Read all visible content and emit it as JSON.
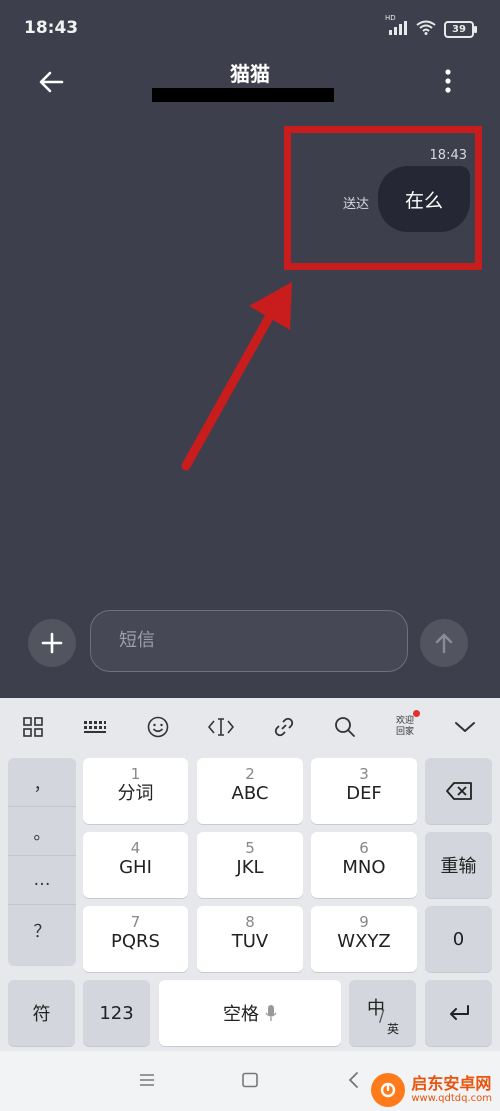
{
  "status": {
    "time": "18:43",
    "battery": "39",
    "network_tag": "HD"
  },
  "header": {
    "contact_name": "猫猫"
  },
  "message": {
    "time": "18:43",
    "status": "送达",
    "text": "在么"
  },
  "input": {
    "placeholder": "短信"
  },
  "keyboard": {
    "toolbar": {
      "welcome_line1": "欢迎",
      "welcome_line2": "回家"
    },
    "punctuation": [
      "，",
      "。",
      "…",
      "？"
    ],
    "keys": [
      {
        "num": "1",
        "label": "分词"
      },
      {
        "num": "2",
        "label": "ABC"
      },
      {
        "num": "3",
        "label": "DEF"
      },
      {
        "num": "4",
        "label": "GHI"
      },
      {
        "num": "5",
        "label": "JKL"
      },
      {
        "num": "6",
        "label": "MNO"
      },
      {
        "num": "7",
        "label": "PQRS"
      },
      {
        "num": "8",
        "label": "TUV"
      },
      {
        "num": "9",
        "label": "WXYZ"
      }
    ],
    "reinput": "重输",
    "zero": "0",
    "symbols": "符",
    "numbers": "123",
    "space": "空格",
    "lang_cn": "中",
    "lang_en": "英"
  },
  "watermark": {
    "cn": "启东安卓网",
    "en": "www.qdtdq.com"
  },
  "colors": {
    "accent_red": "#c91d1d",
    "background": "#3d3f4c",
    "bubble": "#252734"
  }
}
